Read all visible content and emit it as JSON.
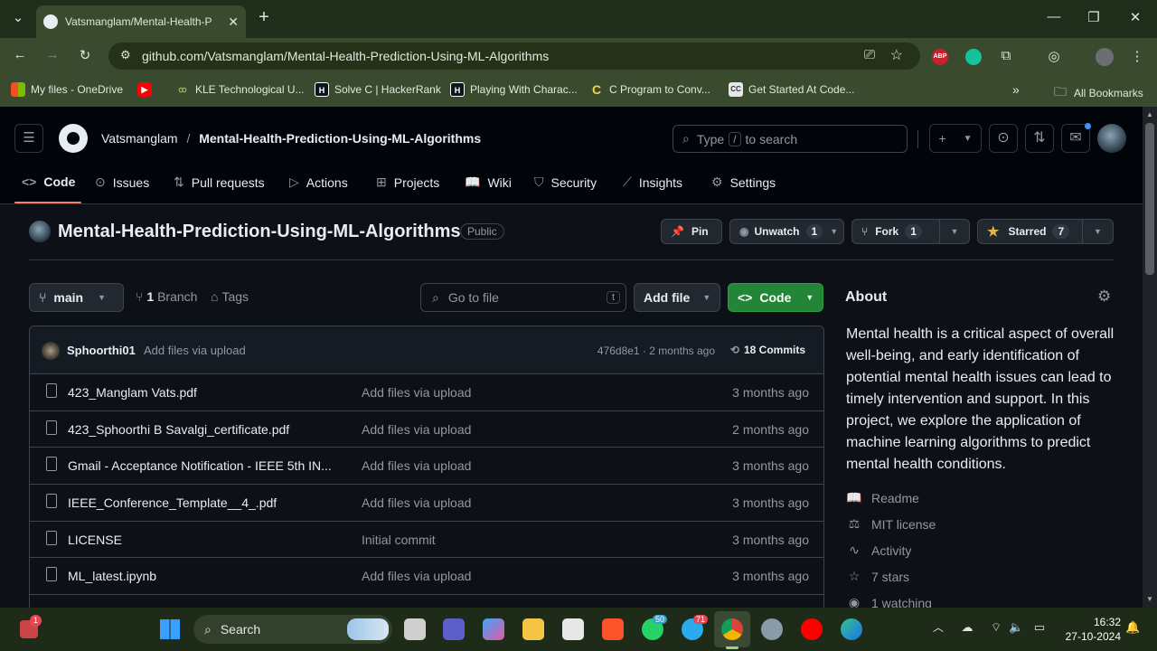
{
  "browser": {
    "tab_title": "Vatsmanglam/Mental-Health-P",
    "url": "github.com/Vatsmanglam/Mental-Health-Prediction-Using-ML-Algorithms",
    "bookmarks": [
      "My files - OneDrive",
      "KLE Technological U...",
      "Solve C | HackerRank",
      "Playing With Charac...",
      "C Program to Conv...",
      "Get Started At Code..."
    ],
    "all_bookmarks": "All Bookmarks",
    "ext_abp": "ABP"
  },
  "gh": {
    "owner": "Vatsmanglam",
    "sep": "/",
    "repo": "Mental-Health-Prediction-Using-ML-Algorithms",
    "search_pre": "Type",
    "search_key": "/",
    "search_post": "to search",
    "nav": [
      "Code",
      "Issues",
      "Pull requests",
      "Actions",
      "Projects",
      "Wiki",
      "Security",
      "Insights",
      "Settings"
    ]
  },
  "repo": {
    "name": "Mental-Health-Prediction-Using-ML-Algorithms",
    "visibility": "Public",
    "pin": "Pin",
    "unwatch": "Unwatch",
    "watch_count": "1",
    "fork": "Fork",
    "fork_count": "1",
    "starred": "Starred",
    "star_count": "7"
  },
  "files": {
    "branch": "main",
    "branches_count": "1",
    "branches_label": "Branch",
    "tags": "Tags",
    "goto": "Go to file",
    "goto_key": "t",
    "add_file": "Add file",
    "code": "Code",
    "commit_author": "Sphoorthi01",
    "commit_msg": "Add files via upload",
    "commit_meta": "476d8e1 · 2 months ago",
    "commits": "18 Commits",
    "rows": [
      {
        "name": "423_Manglam Vats.pdf",
        "msg": "Add files via upload",
        "date": "3 months ago"
      },
      {
        "name": "423_Sphoorthi B Savalgi_certificate.pdf",
        "msg": "Add files via upload",
        "date": "2 months ago"
      },
      {
        "name": "Gmail - Acceptance Notification - IEEE 5th IN...",
        "msg": "Add files via upload",
        "date": "3 months ago"
      },
      {
        "name": "IEEE_Conference_Template__4_.pdf",
        "msg": "Add files via upload",
        "date": "3 months ago"
      },
      {
        "name": "LICENSE",
        "msg": "Initial commit",
        "date": "3 months ago"
      },
      {
        "name": "ML_latest.ipynb",
        "msg": "Add files via upload",
        "date": "3 months ago"
      }
    ]
  },
  "about": {
    "title": "About",
    "description": "Mental health is a critical aspect of overall well-being, and early identification of potential mental health issues can lead to timely intervention and support. In this project, we explore the application of machine learning algorithms to predict mental health conditions.",
    "links": [
      "Readme",
      "MIT license",
      "Activity",
      "7 stars",
      "1 watching"
    ]
  },
  "taskbar": {
    "search": "Search",
    "time": "16:32",
    "date": "27-10-2024",
    "badge_whatsapp": "50",
    "badge_telegram": "71",
    "badge_user": "1"
  }
}
